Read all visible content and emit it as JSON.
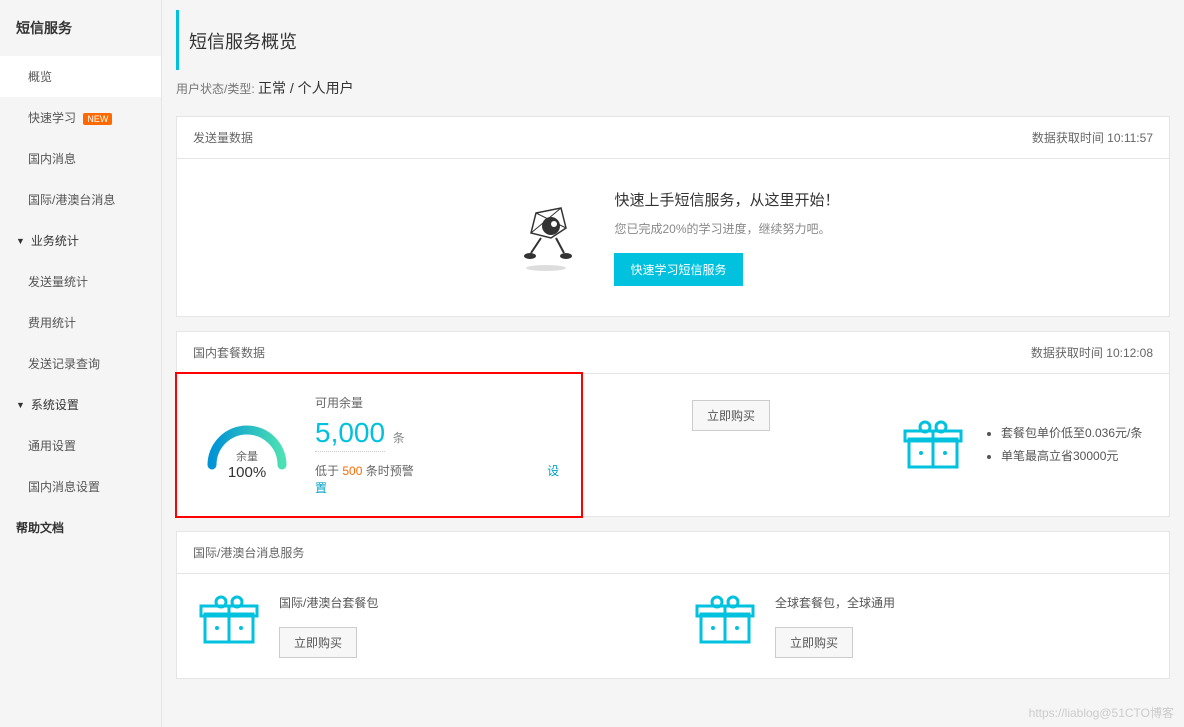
{
  "sidebar": {
    "title": "短信服务",
    "items": [
      {
        "label": "概览",
        "active": true
      },
      {
        "label": "快速学习",
        "badge": "NEW"
      },
      {
        "label": "国内消息"
      },
      {
        "label": "国际/港澳台消息"
      }
    ],
    "groups": [
      {
        "label": "业务统计",
        "children": [
          {
            "label": "发送量统计"
          },
          {
            "label": "费用统计"
          },
          {
            "label": "发送记录查询"
          }
        ]
      },
      {
        "label": "系统设置",
        "children": [
          {
            "label": "通用设置"
          },
          {
            "label": "国内消息设置"
          }
        ]
      }
    ],
    "help": "帮助文档"
  },
  "header": {
    "title": "短信服务概览",
    "user_status_label": "用户状态/类型:",
    "user_status_value": "正常 / 个人用户"
  },
  "send_card": {
    "title": "发送量数据",
    "fetch_label": "数据获取时间",
    "fetch_time": "10:11:57",
    "promo_title": "快速上手短信服务，从这里开始！",
    "promo_desc": "您已完成20%的学习进度，继续努力吧。",
    "promo_btn": "快速学习短信服务"
  },
  "pkg_card": {
    "title": "国内套餐数据",
    "fetch_label": "数据获取时间",
    "fetch_time": "10:12:08",
    "gauge_label": "余量",
    "gauge_pct": "100%",
    "avail_label": "可用余量",
    "avail_amount": "5,000",
    "avail_unit": "条",
    "warn_prefix": "低于",
    "warn_value": "500",
    "warn_suffix": "条时预警",
    "settings_link": "设置",
    "buy_btn": "立即购买",
    "bullets": [
      "套餐包单价低至0.036元/条",
      "单笔最高立省30000元"
    ]
  },
  "intl_card": {
    "title": "国际/港澳台消息服务",
    "left_label": "国际/港澳台套餐包",
    "right_label": "全球套餐包，全球通用",
    "buy_btn": "立即购买"
  },
  "watermark": "https://liablog@51CTO博客"
}
